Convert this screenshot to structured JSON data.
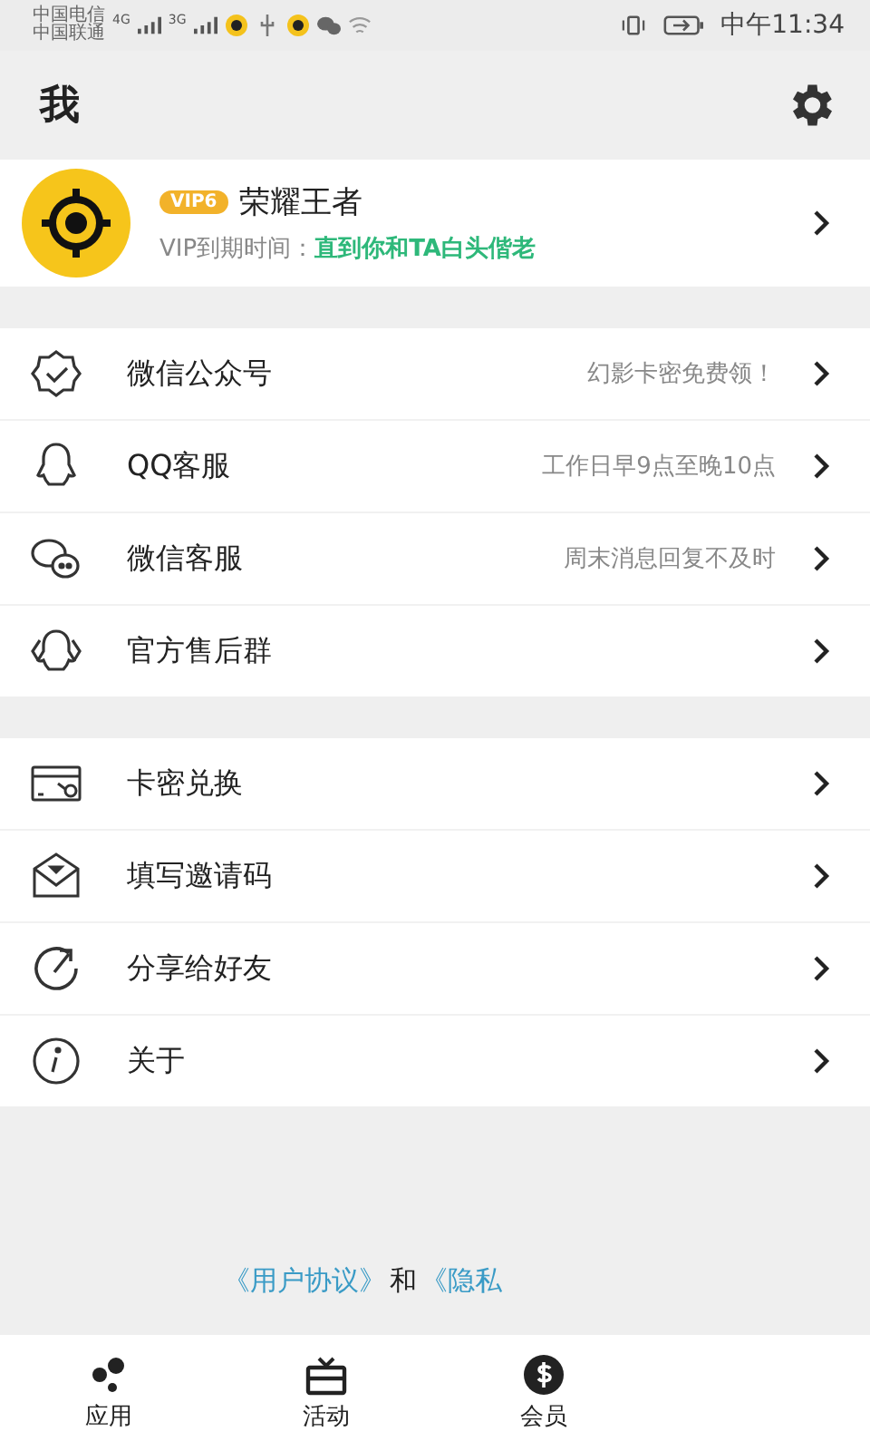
{
  "status_bar": {
    "carriers": [
      "中国电信",
      "中国联通"
    ],
    "networks": [
      "4G",
      "3G"
    ],
    "time": "中午11:34"
  },
  "header": {
    "title": "我"
  },
  "profile": {
    "vip_badge": "VIP6",
    "name": "荣耀王者",
    "expiry_label": "VIP到期时间：",
    "expiry_value": "直到你和TA白头偕老"
  },
  "groups": [
    [
      {
        "kind": "badge",
        "label": "微信公众号",
        "note": "幻影卡密免费领！"
      },
      {
        "kind": "qq",
        "label": "QQ客服",
        "note": "工作日早9点至晚10点"
      },
      {
        "kind": "chat",
        "label": "微信客服",
        "note": "周末消息回复不及时"
      },
      {
        "kind": "group",
        "label": "官方售后群"
      }
    ],
    [
      {
        "kind": "card",
        "label": "卡密兑换"
      },
      {
        "kind": "mail",
        "label": "填写邀请码"
      },
      {
        "kind": "share",
        "label": "分享给好友"
      },
      {
        "kind": "info",
        "label": "关于"
      }
    ]
  ],
  "footer": {
    "link1": "《用户协议》",
    "joiner": "和",
    "link2": "《隐私"
  },
  "tabs": [
    {
      "kind": "apps",
      "label": "应用"
    },
    {
      "kind": "gift",
      "label": "活动"
    },
    {
      "kind": "dollar",
      "label": "会员"
    }
  ]
}
